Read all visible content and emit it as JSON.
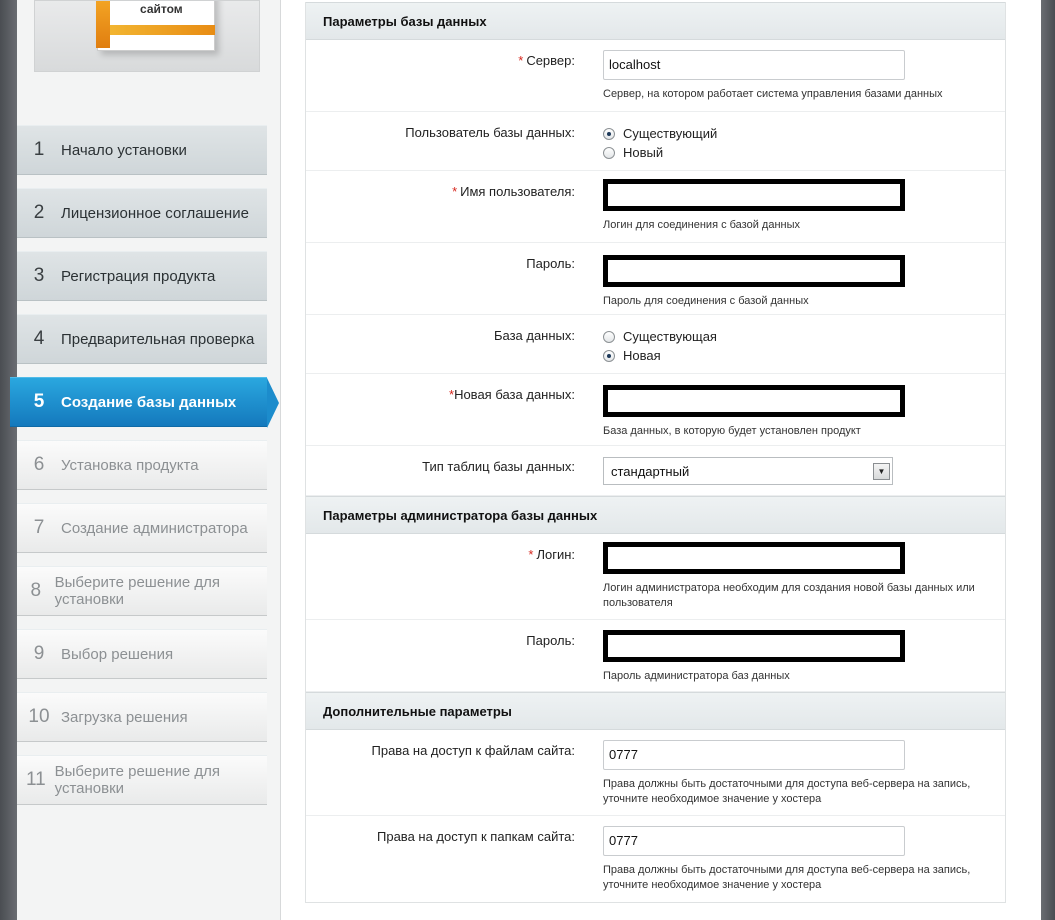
{
  "product": {
    "box_text": "сайтом"
  },
  "steps": [
    {
      "num": "1",
      "title": "Начало установки",
      "state": "done"
    },
    {
      "num": "2",
      "title": "Лицензионное соглашение",
      "state": "done"
    },
    {
      "num": "3",
      "title": "Регистрация продукта",
      "state": "done"
    },
    {
      "num": "4",
      "title": "Предварительная проверка",
      "state": "done"
    },
    {
      "num": "5",
      "title": "Создание базы данных",
      "state": "active"
    },
    {
      "num": "6",
      "title": "Установка продукта",
      "state": "future"
    },
    {
      "num": "7",
      "title": "Создание администратора",
      "state": "future"
    },
    {
      "num": "8",
      "title": "Выберите решение для установки",
      "state": "future"
    },
    {
      "num": "9",
      "title": "Выбор решения",
      "state": "future"
    },
    {
      "num": "10",
      "title": "Загрузка решения",
      "state": "future"
    },
    {
      "num": "11",
      "title": "Выберите решение для установки",
      "state": "future"
    }
  ],
  "db_section": {
    "header": "Параметры базы данных",
    "server": {
      "required_mark": "*",
      "label": "Сервер:",
      "value": "localhost",
      "hint": "Сервер, на котором работает система управления базами данных"
    },
    "db_user": {
      "label": "Пользователь базы данных:",
      "option_existing": "Существующий",
      "option_new": "Новый",
      "selected": "existing"
    },
    "username": {
      "required_mark": "*",
      "label": "Имя пользователя:",
      "hint": "Логин для соединения с базой данных"
    },
    "password": {
      "label": "Пароль:",
      "hint": "Пароль для соединения с базой данных"
    },
    "database": {
      "label": "База данных:",
      "option_existing": "Существующая",
      "option_new": "Новая",
      "selected": "new"
    },
    "new_db": {
      "required_mark": "*",
      "label": "Новая база данных:",
      "hint": "База данных, в которую будет установлен продукт"
    },
    "table_type": {
      "label": "Тип таблиц базы данных:",
      "value": "стандартный"
    }
  },
  "admin_section": {
    "header": "Параметры администратора базы данных",
    "login": {
      "required_mark": "*",
      "label": "Логин:",
      "hint": "Логин администратора необходим для создания новой базы данных или пользователя"
    },
    "password": {
      "label": "Пароль:",
      "hint": "Пароль администратора баз данных"
    }
  },
  "extra_section": {
    "header": "Дополнительные параметры",
    "file_perms": {
      "label": "Права на доступ к файлам сайта:",
      "value": "0777",
      "hint": "Права должны быть достаточными для доступа веб-сервера на запись, уточните необходимое значение у хостера"
    },
    "dir_perms": {
      "label": "Права на доступ к папкам сайта:",
      "value": "0777",
      "hint": "Права должны быть достаточными для доступа веб-сервера на запись, уточните необходимое значение у хостера"
    }
  },
  "colors": {
    "active_step": "#1c8ccc",
    "required": "#d6261d"
  }
}
